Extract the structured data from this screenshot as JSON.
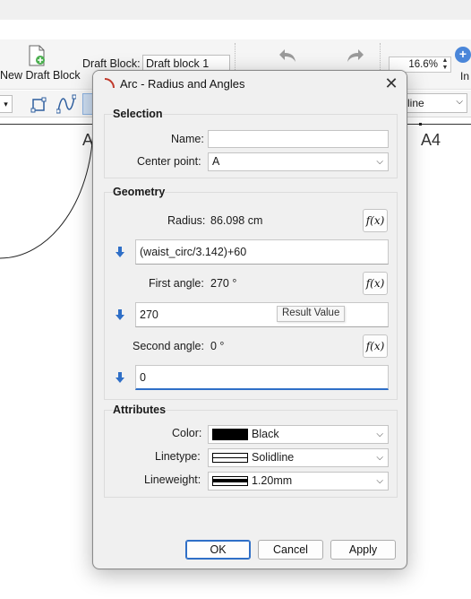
{
  "toolbar": {
    "new_draft_block_label": "New Draft Block",
    "draft_block_label": "Draft Block:",
    "draft_block_value": "Draft block 1",
    "zoom_value": "16.6%",
    "in_label": "In",
    "linetype_value": "line"
  },
  "canvas": {
    "label_a": "A",
    "label_a4": "A4"
  },
  "dialog": {
    "title": "Arc - Radius and Angles",
    "selection": {
      "title": "Selection",
      "name_label": "Name:",
      "name_value": "",
      "center_label": "Center point:",
      "center_value": "A"
    },
    "geometry": {
      "title": "Geometry",
      "radius_label": "Radius:",
      "radius_value": "86.098 cm",
      "radius_formula": "(waist_circ/3.142)+60",
      "first_angle_label": "First angle:",
      "first_angle_value": "270 °",
      "first_angle_formula": "270",
      "tooltip": "Result Value",
      "second_angle_label": "Second angle:",
      "second_angle_value": "0 °",
      "second_angle_formula": "0"
    },
    "attributes": {
      "title": "Attributes",
      "color_label": "Color:",
      "color_value": "Black",
      "linetype_label": "Linetype:",
      "linetype_value": "Solidline",
      "lineweight_label": "Lineweight:",
      "lineweight_value": "1.20mm"
    },
    "buttons": {
      "ok": "OK",
      "cancel": "Cancel",
      "apply": "Apply"
    }
  },
  "colors": {
    "accent": "#2f6fc7",
    "arrow": "#2f6fc7",
    "swatch_black": "#000000"
  },
  "icons": [
    "new-draft-block-icon",
    "undo-icon",
    "redo-icon",
    "arc-tool-icon",
    "close-icon",
    "fx-icon",
    "down-arrow-icon",
    "chevron-down-icon"
  ]
}
